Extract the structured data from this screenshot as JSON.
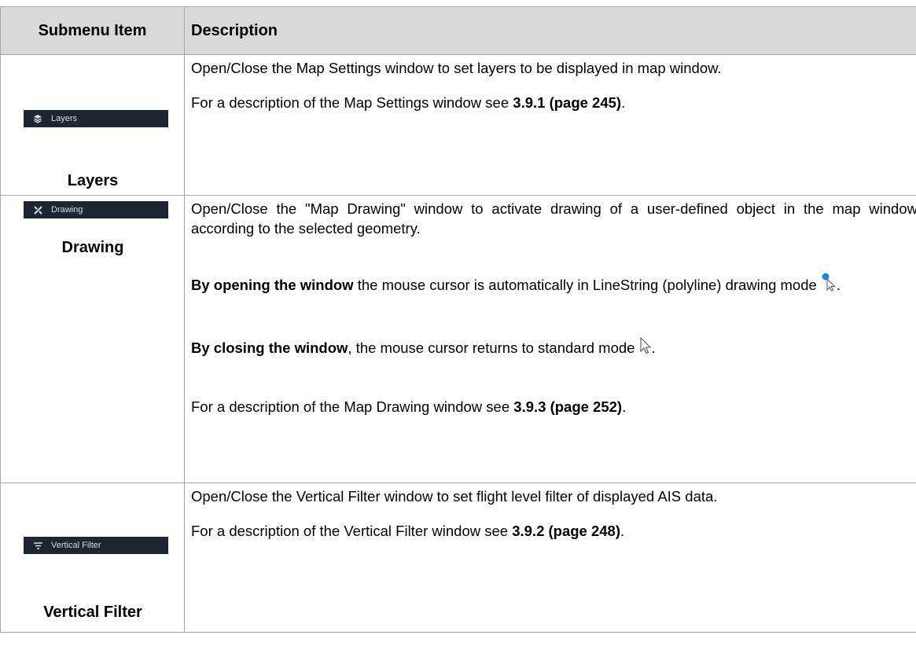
{
  "table": {
    "header": {
      "col1": "Submenu Item",
      "col2": "Description"
    },
    "rows": [
      {
        "button_label": "Layers",
        "item_name": "Layers",
        "desc1": "Open/Close the Map Settings window to set layers to be displayed in map window.",
        "desc2_prefix": "For a description of the Map Settings window see ",
        "desc2_ref": "3.9.1 (page 245)",
        "desc2_suffix": "."
      },
      {
        "button_label": "Drawing",
        "item_name": "Drawing",
        "desc1": "Open/Close the \"Map Drawing\" window to activate drawing of a user-defined object in the map window according to the selected geometry.",
        "open_bold": "By opening the window",
        "open_text": " the mouse cursor is automatically in LineString (polyline) drawing mode ",
        "open_suffix": ".",
        "close_bold": "By closing the window",
        "close_text": ", the mouse cursor returns to standard mode ",
        "close_suffix": ".",
        "ref_prefix": "For a description of the Map Drawing window see ",
        "ref": "3.9.3 (page 252)",
        "ref_suffix": "."
      },
      {
        "button_label": "Vertical Filter",
        "item_name": "Vertical Filter",
        "desc1": "Open/Close the Vertical Filter window to set flight level filter of displayed AIS data.",
        "desc2_prefix": "For a description of the Vertical Filter window see ",
        "desc2_ref": "3.9.2 (page 248)",
        "desc2_suffix": "."
      }
    ]
  },
  "icons": {
    "layers": "layers-icon",
    "drawing": "drawing-tools-icon",
    "vertical_filter": "filter-lines-icon",
    "draw_cursor": "draw-cursor-icon",
    "standard_cursor": "arrow-cursor-icon"
  },
  "colors": {
    "header_bg": "#d9d9d9",
    "button_bg": "#1f2633",
    "button_text": "#d8dce3",
    "cursor_dot": "#1e88d8"
  }
}
